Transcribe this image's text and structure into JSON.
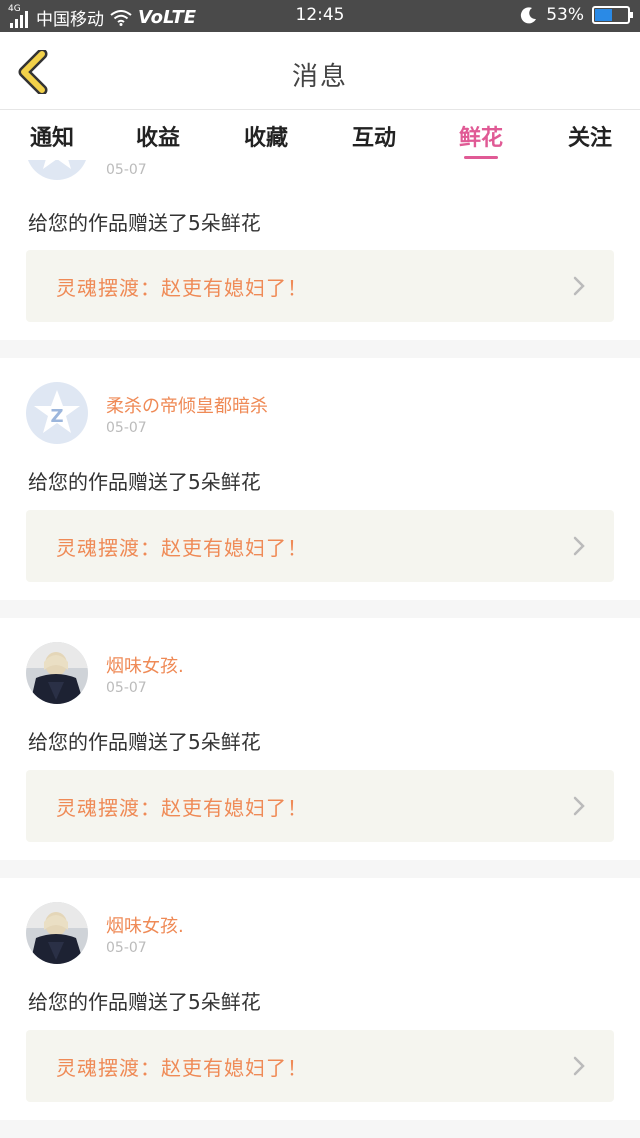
{
  "status_bar": {
    "network_type": "4G",
    "carrier": "中国移动",
    "volte": "VoLTE",
    "time": "12:45",
    "battery_percent": "53%",
    "battery_level": 0.53
  },
  "header": {
    "title": "消息"
  },
  "tabs": [
    {
      "label": "通知",
      "active": false
    },
    {
      "label": "收益",
      "active": false
    },
    {
      "label": "收藏",
      "active": false
    },
    {
      "label": "互动",
      "active": false
    },
    {
      "label": "鲜花",
      "active": true
    },
    {
      "label": "关注",
      "active": false
    }
  ],
  "feed": [
    {
      "username": "",
      "date": "05-07",
      "message": "给您的作品赠送了5朵鲜花",
      "work_title": "灵魂摆渡：赵吏有媳妇了！"
    },
    {
      "username": "柔杀の帝倾皇都暗杀",
      "date": "05-07",
      "message": "给您的作品赠送了5朵鲜花",
      "work_title": "灵魂摆渡：赵吏有媳妇了！"
    },
    {
      "username": "烟味女孩.",
      "date": "05-07",
      "message": "给您的作品赠送了5朵鲜花",
      "work_title": "灵魂摆渡：赵吏有媳妇了！"
    },
    {
      "username": "烟味女孩.",
      "date": "05-07",
      "message": "给您的作品赠送了5朵鲜花",
      "work_title": "灵魂摆渡：赵吏有媳妇了！"
    }
  ],
  "colors": {
    "accent_pink": "#e05a95",
    "username_orange": "#ef8a56",
    "back_icon_yellow": "#f2d14a"
  }
}
